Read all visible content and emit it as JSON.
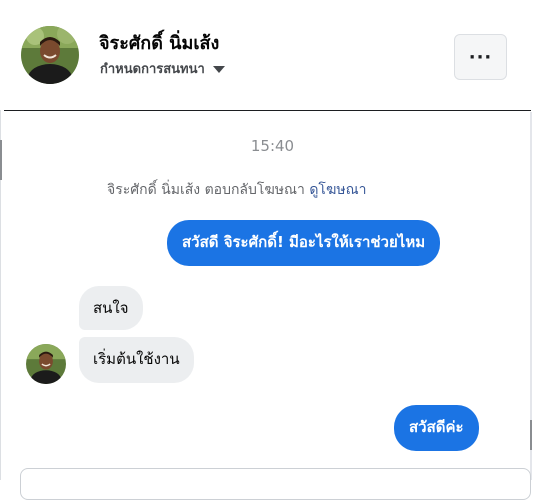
{
  "header": {
    "contact_name": "จิระศักดิ์ นิ่มเส้ง",
    "subtitle": "กำหนดการสนทนา",
    "more_label": "···"
  },
  "thread": {
    "timestamp": "15:40",
    "notice": {
      "text": "จิระศักดิ์ นิ่มเส้ง ตอบกลับโฆษณา",
      "link": "ดูโฆษณา"
    },
    "messages": [
      {
        "direction": "out",
        "text": "สวัสดี จิระศักดิ์! มีอะไรให้เราช่วยไหม"
      },
      {
        "direction": "in",
        "text": "สนใจ"
      },
      {
        "direction": "in",
        "text": "เริ่มต้นใช้งาน"
      },
      {
        "direction": "out",
        "text": "สวัสดีค่ะ"
      }
    ]
  },
  "colors": {
    "outgoing_bubble": "#1b74e4",
    "incoming_bubble": "#eceef0",
    "link": "#385898"
  },
  "icons": [
    "avatar-photo",
    "chevron-down-icon",
    "more-options-icon"
  ]
}
